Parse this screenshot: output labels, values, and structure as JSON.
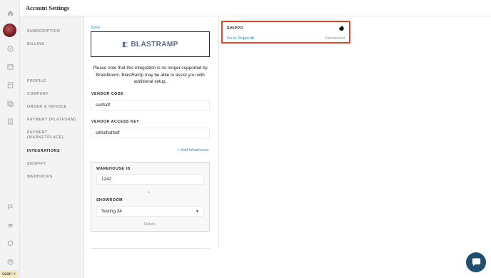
{
  "header": {
    "title": "Account Settings"
  },
  "rail_icons": [
    "home-icon",
    "avatar",
    "tag-icon",
    "box-icon",
    "document-icon",
    "layers-icon",
    "clipboard-icon",
    "flag-icon",
    "graduation-icon",
    "shield-icon",
    "user-icon"
  ],
  "subnav": {
    "items": [
      {
        "label": "SUBSCRIPTION",
        "active": false
      },
      {
        "label": "BILLING",
        "active": false
      },
      {
        "label": "PROFILE",
        "active": false
      },
      {
        "label": "COMPANY",
        "active": false
      },
      {
        "label": "ORDER & INVOICE",
        "active": false
      },
      {
        "label": "PAYMENT (PLATFORM)",
        "active": false
      },
      {
        "label": "PAYMENT (MARKETPLACE)",
        "active": false
      },
      {
        "label": "INTEGRATIONS",
        "active": true
      },
      {
        "label": "SHOPIFY",
        "active": false
      },
      {
        "label": "WEBHOOKS",
        "active": false
      }
    ]
  },
  "integration": {
    "back_label": "Back",
    "logo_text": "BLASTRAMP",
    "notice": "Please note that this integration is no longer supported by Brandboom. BlastRamp may be able to assist you with additional setup.",
    "vendor_code_label": "VENDOR CODE",
    "vendor_code_value": "ssdfsdf",
    "vendor_access_key_label": "VENDOR ACCESS KEY",
    "vendor_access_key_value": "sdfsdfsdfsdf",
    "add_warehouse_label": "+ Add Warehouse",
    "warehouse": {
      "id_label": "WAREHOUSE ID",
      "id_value": "1242",
      "showroom_label": "SHOWROOM",
      "showroom_value": "Testing 34",
      "delete_label": "Delete"
    }
  },
  "shippo": {
    "title": "SHIPPO",
    "link_label": "Go to Shippo ⧉",
    "disconnect_label": "Disconnect"
  },
  "user_tag": {
    "name": "sean",
    "close": "×"
  },
  "colors": {
    "accent": "#2a8fd0",
    "highlight": "#e0472a",
    "chat": "#1f4e6e"
  }
}
